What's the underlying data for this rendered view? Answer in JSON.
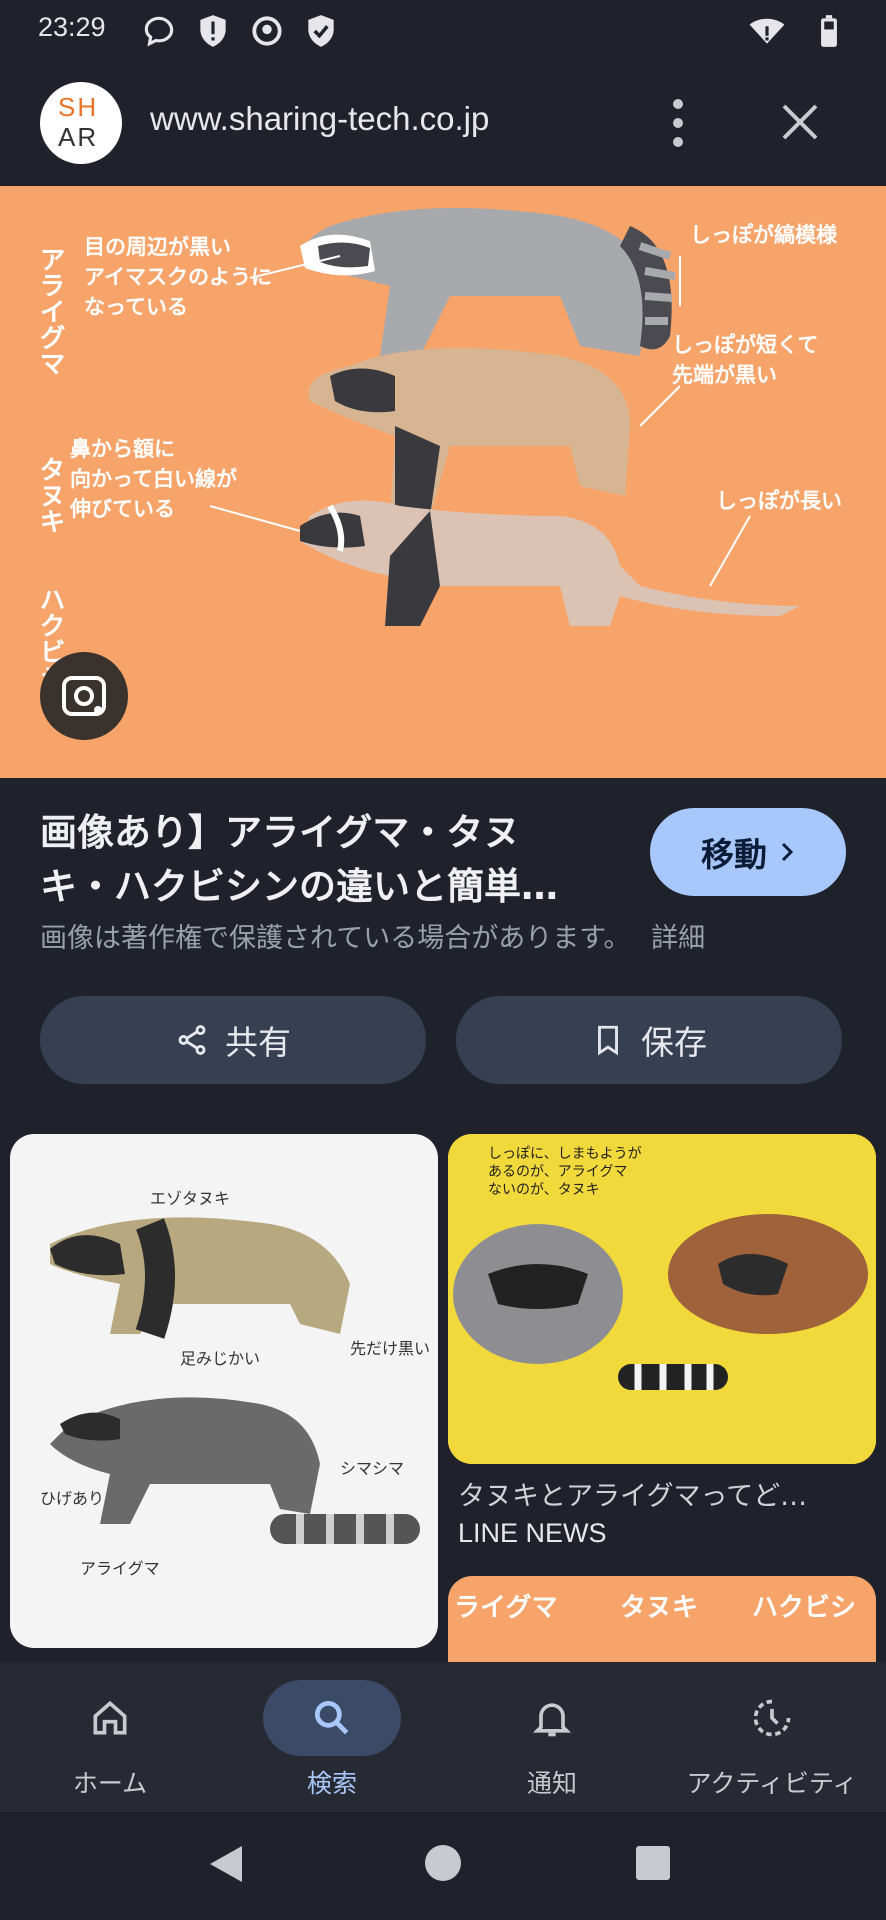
{
  "status_bar": {
    "time": "23:29",
    "left_icons": [
      "chat-bubble-icon",
      "alert-shield-icon",
      "hand-icon",
      "check-shield-icon"
    ],
    "right_icons": [
      "wifi-icon",
      "battery-icon"
    ]
  },
  "top_bar": {
    "favicon_text_top": "SH",
    "favicon_text_bottom": "AR",
    "url": "www.sharing-tech.co.jp",
    "menu_icon": "more-vert-icon",
    "close_icon": "close-icon"
  },
  "hero": {
    "vertical_labels": [
      "アライグマ",
      "タヌキ",
      "ハクビシン"
    ],
    "annotation_1": [
      "目の周辺が黒い",
      "アイマスクのように",
      "なっている"
    ],
    "annotation_2": [
      "しっぽが縞模様"
    ],
    "annotation_3": [
      "しっぽが短くて",
      "先端が黒い"
    ],
    "annotation_4": [
      "鼻から額に",
      "向かって白い線が",
      "伸びている"
    ],
    "annotation_5": [
      "しっぽが長い"
    ],
    "lens_icon": "lens-icon"
  },
  "result": {
    "title_line1": "画像あり】アライグマ・タヌ",
    "title_line2": "キ・ハクビシンの違いと簡単…",
    "move_label": "移動",
    "copyright_text": "画像は著作権で保護されている場合があります。",
    "detail_link": "詳細",
    "share_label": "共有",
    "save_label": "保存"
  },
  "related": [
    {
      "title": "",
      "source": "",
      "image_labels": [
        "エゾタヌキ",
        "足みじかい",
        "先だけ黒い",
        "シマシマ",
        "アライグマ",
        "ひげあり"
      ]
    },
    {
      "title": "タヌキとアライグマってど…",
      "source": "LINE NEWS",
      "image_labels": [
        "しっぽに、しまもようが",
        "あるのが、アライグマ",
        "ないのが、タヌキ"
      ]
    },
    {
      "title": "",
      "source": "",
      "image_labels": [
        "ライグマ",
        "タヌキ",
        "ハクビシ"
      ]
    }
  ],
  "bottom_nav": {
    "items": [
      {
        "label": "ホーム",
        "icon": "home-icon"
      },
      {
        "label": "検索",
        "icon": "search-icon"
      },
      {
        "label": "通知",
        "icon": "bell-icon"
      },
      {
        "label": "アクティビティ",
        "icon": "activity-icon"
      }
    ]
  },
  "colors": {
    "background": "#1f222a",
    "accent": "#a8c7fa",
    "hero_orange": "#f7a46b",
    "button_bg": "#364052",
    "nav_active_pill": "#3b4a66"
  }
}
